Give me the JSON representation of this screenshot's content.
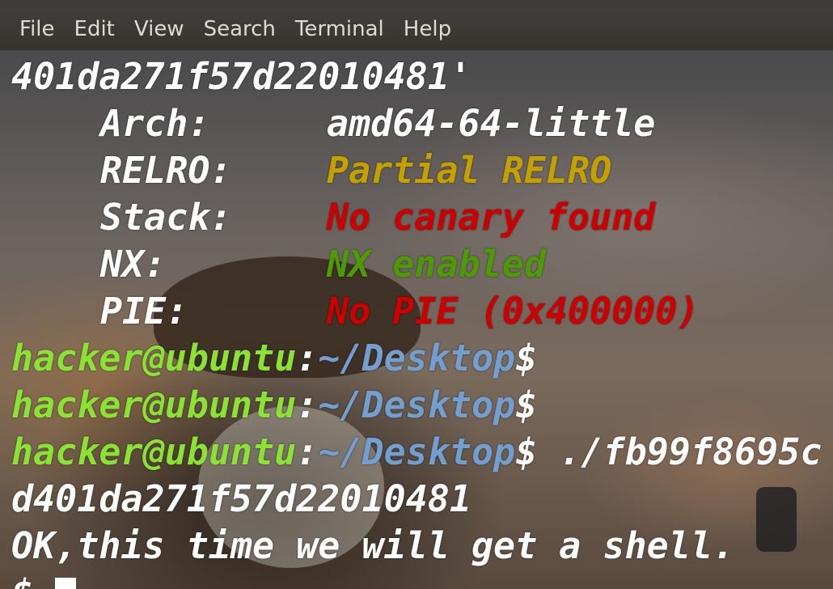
{
  "menu": [
    "File",
    "Edit",
    "View",
    "Search",
    "Terminal",
    "Help"
  ],
  "terminal": {
    "line0": "401da271f57d22010481'",
    "checksec": [
      {
        "label": "Arch:",
        "value": "amd64-64-little",
        "color": "#ffffff"
      },
      {
        "label": "RELRO:",
        "value": "Partial RELRO",
        "color": "#c4a000"
      },
      {
        "label": "Stack:",
        "value": "No canary found",
        "color": "#cc0000"
      },
      {
        "label": "NX:",
        "value": "NX enabled",
        "color": "#4e9a06"
      },
      {
        "label": "PIE:",
        "value": "No PIE (0x400000)",
        "color": "#cc0000"
      }
    ],
    "prompt": {
      "user": "hacker@ubuntu",
      "sep": ":",
      "path": "~/Desktop",
      "symbol": "$"
    },
    "command": " ./fb99f8695c",
    "line_hash": "d401da271f57d22010481",
    "line_msg": "OK,this time we will get a shell.",
    "shell_prompt": "$ "
  },
  "colors": {
    "prompt_user": "#8ae234",
    "prompt_path": "#729fcf",
    "yellow": "#c4a000",
    "red": "#cc0000",
    "green": "#4e9a06"
  }
}
